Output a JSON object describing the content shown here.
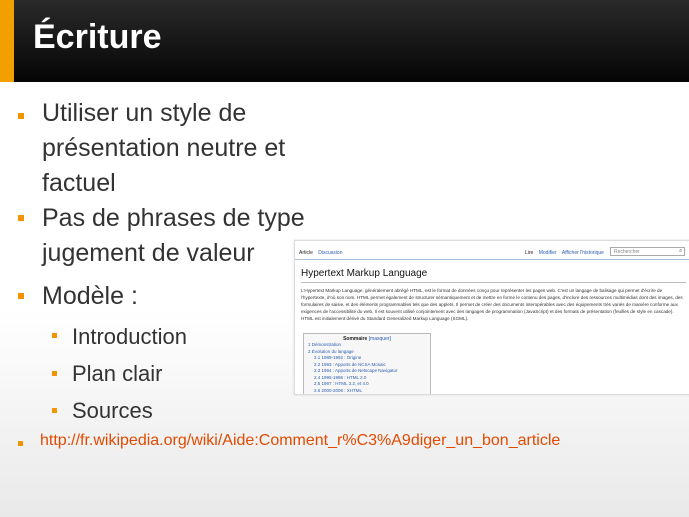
{
  "slide": {
    "title": "Écriture",
    "bullets": [
      {
        "lines": [
          "Utiliser un style de",
          "présentation neutre et",
          "factuel"
        ]
      },
      {
        "lines": [
          "Pas de phrases de type",
          "jugement de valeur"
        ]
      },
      {
        "lines": [
          "Modèle :"
        ]
      }
    ],
    "subbullets": [
      "Introduction",
      "Plan clair",
      "Sources"
    ],
    "link": "http://fr.wikipedia.org/wiki/Aide:Comment_r%C3%A9diger_un_bon_article"
  },
  "screenshot": {
    "tab_article": "Article",
    "tab_discussion": "Discussion",
    "tab_read": "Lire",
    "tab_edit": "Modifier",
    "tab_history": "Afficher l'historique",
    "search_placeholder": "Rechercher",
    "heading": "Hypertext Markup Language",
    "paragraph": "L'Hypertext Markup Language, généralement abrégé HTML, est le format de données conçu pour représenter les pages web. C'est un langage de balisage qui permet d'écrire de l'hypertexte, d'où son nom. HTML permet également de structurer sémantiquement et de mettre en forme le contenu des pages, d'inclure des ressources multimédias dont des images, des formulaires de saisie, et des éléments programmables tels que des applets. Il permet de créer des documents interopérables avec des équipements très variés de manière conforme aux exigences de l'accessibilité du web. Il est souvent utilisé conjointement avec des langages de programmation (JavaScript) et des formats de présentation (feuilles de style en cascade). HTML est initialement dérivé du Standard Generalized Markup Language (SGML).",
    "toc_title": "Sommaire",
    "toc_toggle": "[masquer]",
    "toc_items": [
      "1 Démonstration",
      "2 Évolution du langage",
      "2.1 1989-1992 : Origine",
      "2.2 1993 : Apports de NCSA Mosaic",
      "2.3 1994 : Apports de Netscape Navigator",
      "2.4 1995-1996 : HTML 2.0",
      "2.5 1997 : HTML 3.2, et 4.0",
      "2.6 2000-2006 : XHTML"
    ]
  },
  "colors": {
    "accent": "#f2a000",
    "link": "#e34a00",
    "text": "#333333"
  }
}
